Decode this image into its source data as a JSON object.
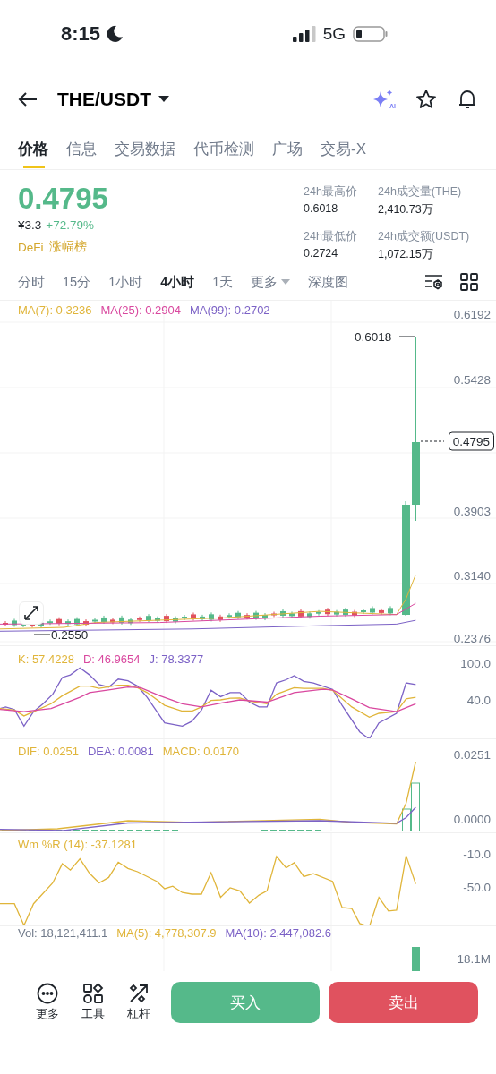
{
  "status_bar": {
    "time": "8:15",
    "network": "5G"
  },
  "header": {
    "title": "THE/USDT",
    "ai_badge": "AI"
  },
  "tabs": [
    {
      "label": "价格",
      "selected": true
    },
    {
      "label": "信息",
      "selected": false
    },
    {
      "label": "交易数据",
      "selected": false
    },
    {
      "label": "代币检测",
      "selected": false
    },
    {
      "label": "广场",
      "selected": false
    },
    {
      "label": "交易-X",
      "selected": false
    }
  ],
  "price": {
    "last": "0.4795",
    "cny": "¥3.3",
    "change": "+72.79%",
    "tags": [
      "DeFi",
      "涨幅榜"
    ]
  },
  "stats": [
    {
      "label": "24h最高价",
      "value": "0.6018"
    },
    {
      "label": "24h成交量(THE)",
      "value": "2,410.73万"
    },
    {
      "label": "24h最低价",
      "value": "0.2724"
    },
    {
      "label": "24h成交额(USDT)",
      "value": "1,072.15万"
    }
  ],
  "intervals": [
    {
      "label": "分时",
      "kind": "plain",
      "selected": false
    },
    {
      "label": "15分",
      "kind": "plain",
      "selected": false
    },
    {
      "label": "1小时",
      "kind": "plain",
      "selected": false
    },
    {
      "label": "4小时",
      "kind": "plain",
      "selected": true
    },
    {
      "label": "1天",
      "kind": "plain",
      "selected": false
    },
    {
      "label": "更多",
      "kind": "dropdown",
      "selected": false
    },
    {
      "label": "深度图",
      "kind": "plain",
      "selected": false
    }
  ],
  "panels": [
    {
      "kind": "candles",
      "legend": [
        {
          "text": "MA(7): 0.3236",
          "color": "#e0b53a"
        },
        {
          "text": "MA(25): 0.2904",
          "color": "#d9489f"
        },
        {
          "text": "MA(99): 0.2702",
          "color": "#7c62c6"
        }
      ],
      "axis": [
        "0.6192",
        "0.5428",
        "0.3903",
        "0.3140",
        "0.2376"
      ],
      "high_label": "0.6018",
      "low_label": "0.2550",
      "last_price": "0.4795"
    },
    {
      "kind": "kdj",
      "legend": [
        {
          "text": "K: 57.4228",
          "color": "#e0b53a"
        },
        {
          "text": "D: 46.9654",
          "color": "#d9489f"
        },
        {
          "text": "J: 78.3377",
          "color": "#7c62c6"
        }
      ],
      "axis": [
        "100.0",
        "40.0"
      ]
    },
    {
      "kind": "macd",
      "legend": [
        {
          "text": "DIF: 0.0251",
          "color": "#e0b53a"
        },
        {
          "text": "DEA: 0.0081",
          "color": "#7c62c6"
        },
        {
          "text": "MACD: 0.0170",
          "color": "#e0b53a"
        }
      ],
      "axis": [
        "0.0251",
        "0.0000"
      ]
    },
    {
      "kind": "wr",
      "legend": [
        {
          "text": "Wm %R (14): -37.1281",
          "color": "#e0b53a"
        }
      ],
      "axis": [
        "-10.0",
        "-50.0"
      ]
    },
    {
      "kind": "volume",
      "legend": [
        {
          "text": "Vol: 18,121,411.1",
          "color": "#707a8a"
        },
        {
          "text": "MA(5): 4,778,307.9",
          "color": "#e0b53a"
        },
        {
          "text": "MA(10): 2,447,082.6",
          "color": "#7c62c6"
        }
      ],
      "axis": [
        "18.1M"
      ]
    }
  ],
  "bottom_actions": [
    {
      "label": "更多",
      "kind": "more"
    },
    {
      "label": "工具",
      "kind": "tools"
    },
    {
      "label": "杠杆",
      "kind": "leverage"
    }
  ],
  "trade_buttons": [
    {
      "label": "买入",
      "kind": "buy"
    },
    {
      "label": "卖出",
      "kind": "sell"
    }
  ]
}
